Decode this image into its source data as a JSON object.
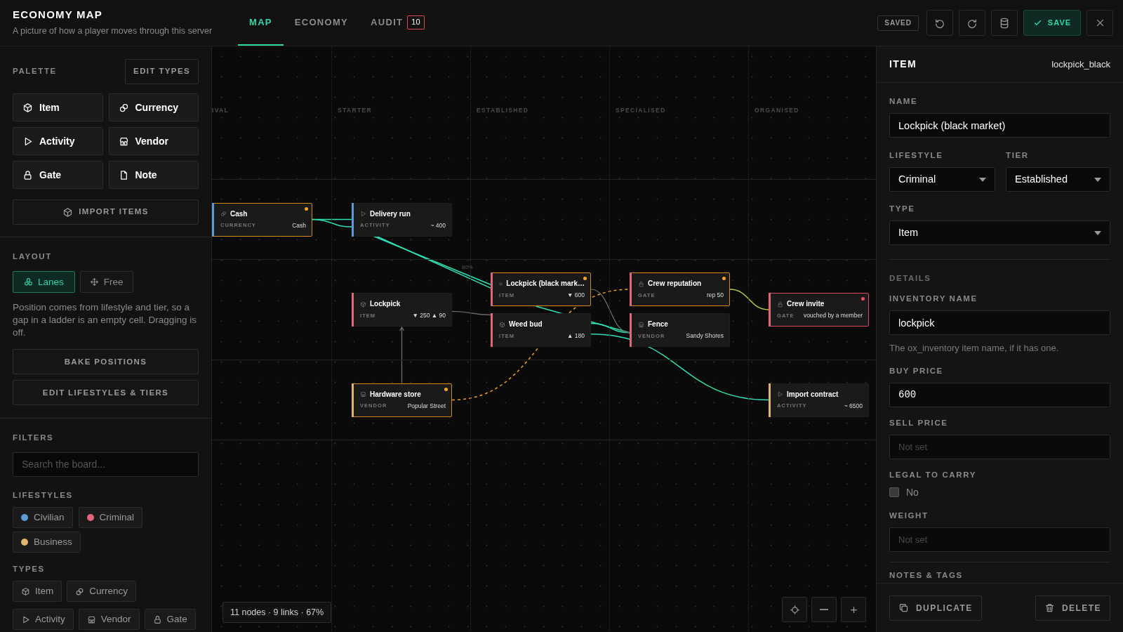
{
  "header": {
    "title": "ECONOMY MAP",
    "subtitle": "A picture of how a player moves through this server"
  },
  "tabs": [
    {
      "label": "MAP",
      "selected": true
    },
    {
      "label": "ECONOMY",
      "selected": false
    },
    {
      "label": "AUDIT",
      "selected": false,
      "badge": "10"
    }
  ],
  "toolbar": {
    "status": "SAVED",
    "save": "SAVE"
  },
  "sidebar": {
    "palette": {
      "title": "PALETTE",
      "edit_button": "EDIT TYPES",
      "items": [
        {
          "label": "Item",
          "kind": "item"
        },
        {
          "label": "Currency",
          "kind": "currency"
        },
        {
          "label": "Activity",
          "kind": "activity"
        },
        {
          "label": "Vendor",
          "kind": "vendor"
        },
        {
          "label": "Gate",
          "kind": "gate"
        },
        {
          "label": "Note",
          "kind": "note"
        }
      ],
      "import_button": "IMPORT ITEMS"
    },
    "layout": {
      "title": "LAYOUT",
      "modes": [
        {
          "label": "Lanes",
          "kind": "lanes",
          "selected": true
        },
        {
          "label": "Free",
          "kind": "free",
          "selected": false
        }
      ],
      "description": "Position comes from lifestyle and tier, so a gap in a ladder is an empty cell. Dragging is off.",
      "buttons": [
        "BAKE POSITIONS",
        "EDIT LIFESTYLES & TIERS"
      ]
    },
    "filters": {
      "title": "FILTERS",
      "search_placeholder": "Search the board...",
      "lifestyles_title": "LIFESTYLES",
      "lifestyles": [
        {
          "label": "Civilian",
          "color": "#5b9bd8"
        },
        {
          "label": "Criminal",
          "color": "#e0667c"
        },
        {
          "label": "Business",
          "color": "#e2b36e"
        }
      ],
      "types_title": "TYPES",
      "types": [
        {
          "label": "Item",
          "kind": "item"
        },
        {
          "label": "Currency",
          "kind": "currency"
        },
        {
          "label": "Activity",
          "kind": "activity"
        },
        {
          "label": "Vendor",
          "kind": "vendor"
        },
        {
          "label": "Gate",
          "kind": "gate"
        }
      ]
    }
  },
  "board": {
    "tiers": [
      {
        "label": "IVAL"
      },
      {
        "label": "STARTER"
      },
      {
        "label": "ESTABLISHED"
      },
      {
        "label": "SPECIALISED"
      },
      {
        "label": "ORGANISED"
      }
    ],
    "lanes": [
      {
        "cells": [
          {
            "nodes": [
              {
                "title": "Cash",
                "type": "CURRENCY",
                "kind": "currency",
                "value": "Cash",
                "color": "#5b9bd8",
                "warning": true,
                "error": false
              }
            ]
          },
          {
            "nodes": [
              {
                "title": "Delivery run",
                "type": "ACTIVITY",
                "kind": "activity",
                "value": "~ 400",
                "color": "#5b9bd8",
                "warning": false,
                "error": false
              }
            ]
          },
          {},
          {},
          {}
        ]
      },
      {
        "cells": [
          {},
          {
            "nodes": [
              {
                "title": "Lockpick",
                "type": "ITEM",
                "kind": "item",
                "value": "▼ 250 ▲ 90",
                "color": "#e0667c",
                "warning": false,
                "error": false
              }
            ]
          },
          {
            "nodes": [
              {
                "title": "Lockpick (black mark…",
                "type": "ITEM",
                "kind": "item",
                "value": "▼ 600",
                "color": "#e0667c",
                "warning": true,
                "error": false
              },
              {
                "title": "Weed bud",
                "type": "ITEM",
                "kind": "item",
                "value": "▲ 180",
                "color": "#e0667c",
                "warning": false,
                "error": false
              }
            ]
          },
          {
            "nodes": [
              {
                "title": "Crew reputation",
                "type": "GATE",
                "kind": "gate",
                "value": "rep 50",
                "color": "#e0667c",
                "warning": true,
                "error": false
              },
              {
                "title": "Fence",
                "type": "VENDOR",
                "kind": "vendor",
                "value": "Sandy Shores",
                "color": "#e0667c",
                "warning": false,
                "error": false
              }
            ]
          },
          {
            "nodes": [
              {
                "title": "Crew invite",
                "type": "GATE",
                "kind": "gate",
                "value": "vouched by a member",
                "color": "#e0667c",
                "warning": false,
                "error": true
              }
            ]
          }
        ]
      },
      {
        "cells": [
          {},
          {
            "nodes": [
              {
                "title": "Hardware store",
                "type": "VENDOR",
                "kind": "vendor",
                "value": "Popular Street",
                "color": "#e2b36e",
                "warning": true,
                "error": false
              }
            ]
          },
          {},
          {},
          {
            "nodes": [
              {
                "title": "Import contract",
                "type": "ACTIVITY",
                "kind": "activity",
                "value": "~ 6500",
                "color": "#e2b36e",
                "warning": false,
                "error": false
              }
            ]
          }
        ]
      }
    ],
    "link_label": "80%",
    "status": "11 nodes · 9 links · 67%"
  },
  "inspector": {
    "title": "ITEM",
    "key": "lockpick_black",
    "name": {
      "label": "NAME",
      "value": "Lockpick (black market)"
    },
    "lifestyle": {
      "label": "LIFESTYLE",
      "value": "Criminal"
    },
    "tier": {
      "label": "TIER",
      "value": "Established"
    },
    "type": {
      "label": "TYPE",
      "value": "Item"
    },
    "details": {
      "title": "DETAILS",
      "fields": [
        {
          "kind": "text",
          "label": "INVENTORY NAME",
          "value": "lockpick",
          "hint": "The ox_inventory item name, if it has one."
        },
        {
          "kind": "number",
          "label": "BUY PRICE",
          "value": "600"
        },
        {
          "kind": "number",
          "label": "SELL PRICE",
          "placeholder": "Not set"
        },
        {
          "kind": "checkbox",
          "label": "LEGAL TO CARRY",
          "checked": false,
          "text": "No"
        },
        {
          "kind": "number",
          "label": "WEIGHT",
          "placeholder": "Not set"
        }
      ]
    },
    "next_section": "NOTES & TAGS",
    "buttons": [
      {
        "label": "DUPLICATE",
        "kind": "duplicate"
      },
      {
        "label": "DELETE",
        "kind": "delete"
      }
    ]
  }
}
